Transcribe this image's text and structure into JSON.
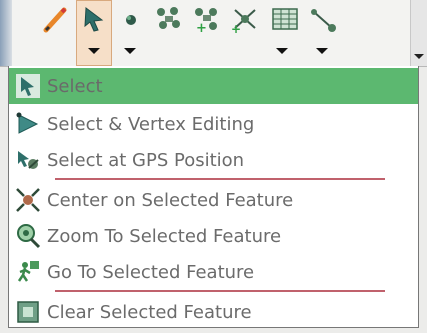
{
  "toolbar": {
    "tools": [
      {
        "name": "pencil-tool",
        "icon": "pencil-icon"
      },
      {
        "name": "select-tool",
        "icon": "select-cursor-icon",
        "active": true
      },
      {
        "name": "point-tool",
        "icon": "point-icon"
      },
      {
        "name": "features-tool",
        "icon": "features-icon"
      },
      {
        "name": "add-features-tool",
        "icon": "add-features-icon"
      },
      {
        "name": "connect-features-tool",
        "icon": "connect-features-icon"
      },
      {
        "name": "table-tool",
        "icon": "table-icon"
      },
      {
        "name": "line-tool",
        "icon": "line-icon"
      }
    ]
  },
  "menu": {
    "items": [
      {
        "label": "Select",
        "icon": "select-cursor-icon",
        "selected": true
      },
      {
        "label": "Select & Vertex Editing",
        "icon": "vertex-edit-icon"
      },
      {
        "label": "Select at GPS Position",
        "icon": "gps-select-icon"
      },
      {
        "label": "Center on Selected Feature",
        "icon": "center-feature-icon"
      },
      {
        "label": "Zoom To Selected Feature",
        "icon": "zoom-feature-icon"
      },
      {
        "label": "Go To Selected Feature",
        "icon": "goto-feature-icon"
      },
      {
        "label": "Clear Selected Feature",
        "icon": "clear-selection-icon"
      }
    ]
  },
  "colors": {
    "highlight": "#5cb870",
    "separator": "#c0616c",
    "text": "#6b6b6b",
    "active_tool_bg": "#f6dfc8"
  }
}
